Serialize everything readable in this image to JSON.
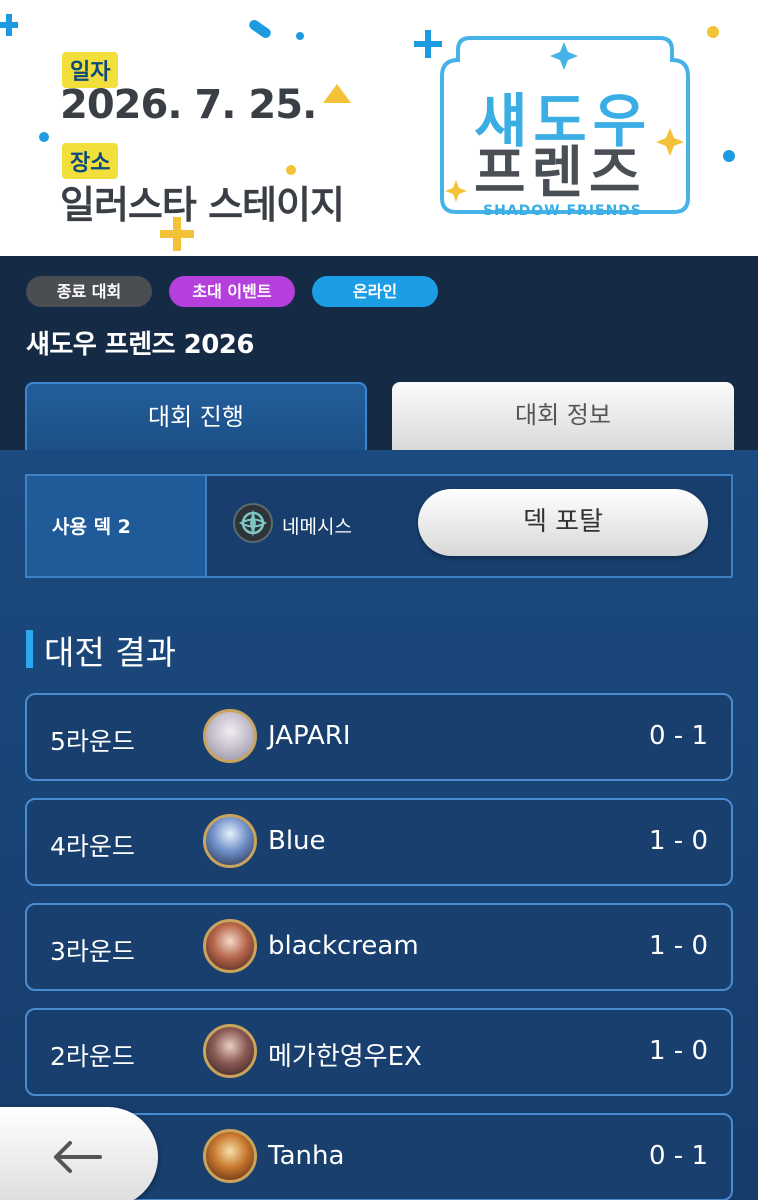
{
  "banner": {
    "date_tag": "일자",
    "date": "2026. 7. 25.",
    "venue_tag": "장소",
    "venue": "일러스타 스테이지",
    "logo_line1": "섀도우",
    "logo_line2": "프렌즈",
    "logo_sub": "SHADOW FRIENDS"
  },
  "badges": [
    "종료 대회",
    "초대 이벤트",
    "온라인"
  ],
  "event_title": "섀도우 프렌즈 2026",
  "tabs": [
    {
      "label": "대회 진행",
      "active": true
    },
    {
      "label": "대회 정보",
      "active": false
    }
  ],
  "deck": {
    "label": "사용 덱 2",
    "class_icon": "nemesis-class-icon",
    "class_name": "네메시스",
    "portal_label": "덱 포탈"
  },
  "results": {
    "title": "대전 결과",
    "matches": [
      {
        "round": "5라운드",
        "opponent": "JAPARI",
        "score": "0 - 1",
        "avatar": "avatar-silver-hair"
      },
      {
        "round": "4라운드",
        "opponent": "Blue",
        "score": "1 - 0",
        "avatar": "avatar-orca"
      },
      {
        "round": "3라운드",
        "opponent": "blackcream",
        "score": "1 - 0",
        "avatar": "avatar-brown-hair"
      },
      {
        "round": "2라운드",
        "opponent": "메가한영우EX",
        "score": "1 - 0",
        "avatar": "avatar-dark-hair"
      },
      {
        "round": "",
        "opponent": "Tanha",
        "score": "0 - 1",
        "avatar": "avatar-blonde"
      }
    ]
  },
  "colors": {
    "accent": "#27aaf0",
    "badge_end": "#4a4d52",
    "badge_invite": "#b540de",
    "badge_online": "#1c9ee6",
    "header_bg": "#152a44",
    "content_bg": "#1b4a80"
  }
}
